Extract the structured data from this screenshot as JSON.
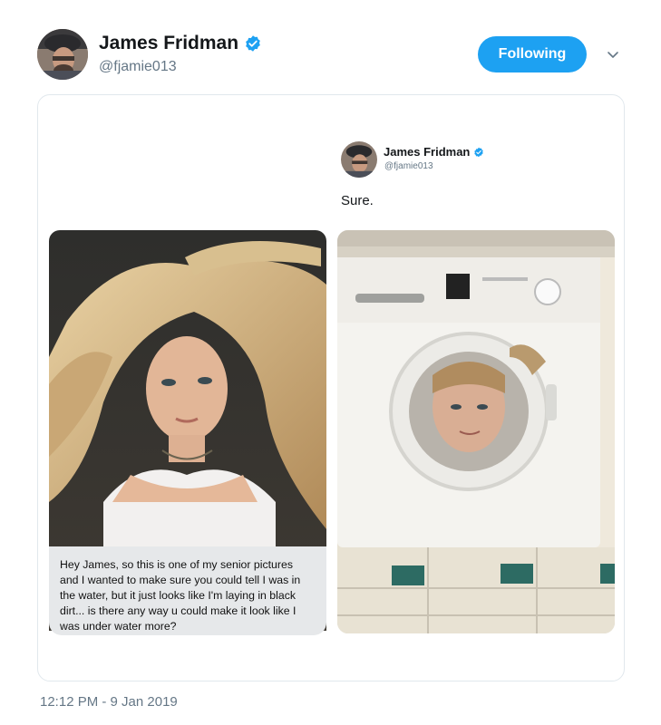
{
  "author": {
    "name": "James Fridman",
    "handle": "@fjamie013",
    "verified_icon": "verified-badge-icon"
  },
  "follow_button": {
    "label": "Following"
  },
  "menu_icon": "chevron-down-icon",
  "embedded": {
    "author_name": "James Fridman",
    "author_handle": "@fjamie013",
    "reply_text": "Sure."
  },
  "message": {
    "lines": [
      "Hey James, so this is one of my senior pictures",
      "and I wanted to make sure you could tell I was in",
      "the water, but it just looks like I'm laying in black",
      "dirt... is there any way u could make it look like I",
      "was under water more?"
    ]
  },
  "timestamp": "12:12 PM - 9 Jan 2019",
  "colors": {
    "accent": "#1da1f2",
    "muted": "#657786",
    "border": "#e1e8ed"
  }
}
